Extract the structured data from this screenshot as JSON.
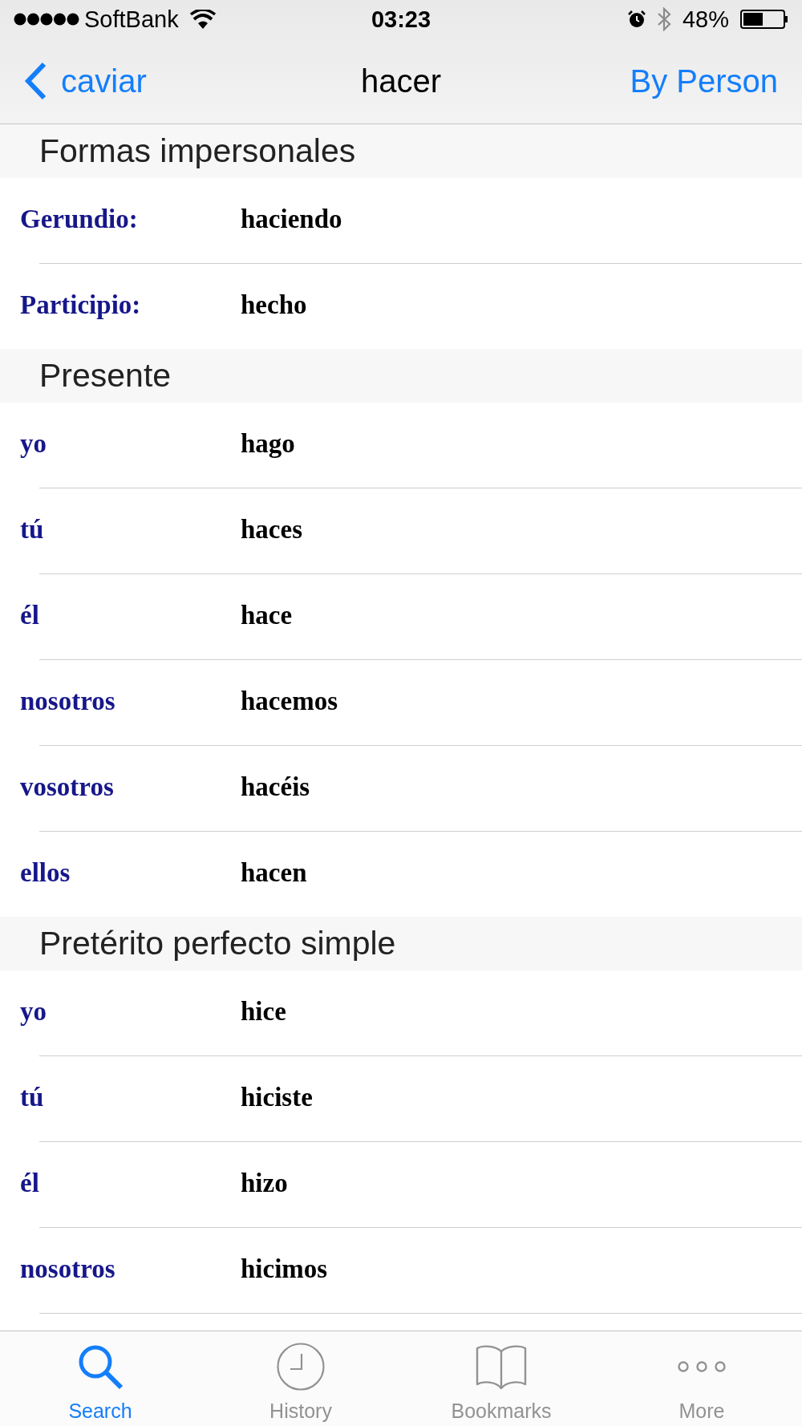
{
  "status_bar": {
    "carrier": "SoftBank",
    "time": "03:23",
    "battery_percent": "48%"
  },
  "nav_bar": {
    "back_label": "caviar",
    "title": "hacer",
    "right_button": "By Person"
  },
  "sections": [
    {
      "title": "Formas impersonales",
      "rows": [
        {
          "label": "Gerundio:",
          "value": "haciendo"
        },
        {
          "label": "Participio:",
          "value": "hecho"
        }
      ]
    },
    {
      "title": "Presente",
      "rows": [
        {
          "label": "yo",
          "value": "hago"
        },
        {
          "label": "tú",
          "value": "haces"
        },
        {
          "label": "él",
          "value": "hace"
        },
        {
          "label": "nosotros",
          "value": "hacemos"
        },
        {
          "label": "vosotros",
          "value": "hacéis"
        },
        {
          "label": "ellos",
          "value": "hacen"
        }
      ]
    },
    {
      "title": "Pretérito perfecto simple",
      "rows": [
        {
          "label": "yo",
          "value": "hice"
        },
        {
          "label": "tú",
          "value": "hiciste"
        },
        {
          "label": "él",
          "value": "hizo"
        },
        {
          "label": "nosotros",
          "value": "hicimos"
        }
      ]
    }
  ],
  "tab_bar": {
    "tabs": [
      {
        "kind": "search",
        "label": "Search",
        "selected": true
      },
      {
        "kind": "history",
        "label": "History",
        "selected": false
      },
      {
        "kind": "bookmarks",
        "label": "Bookmarks",
        "selected": false
      },
      {
        "kind": "more",
        "label": "More",
        "selected": false
      }
    ]
  }
}
